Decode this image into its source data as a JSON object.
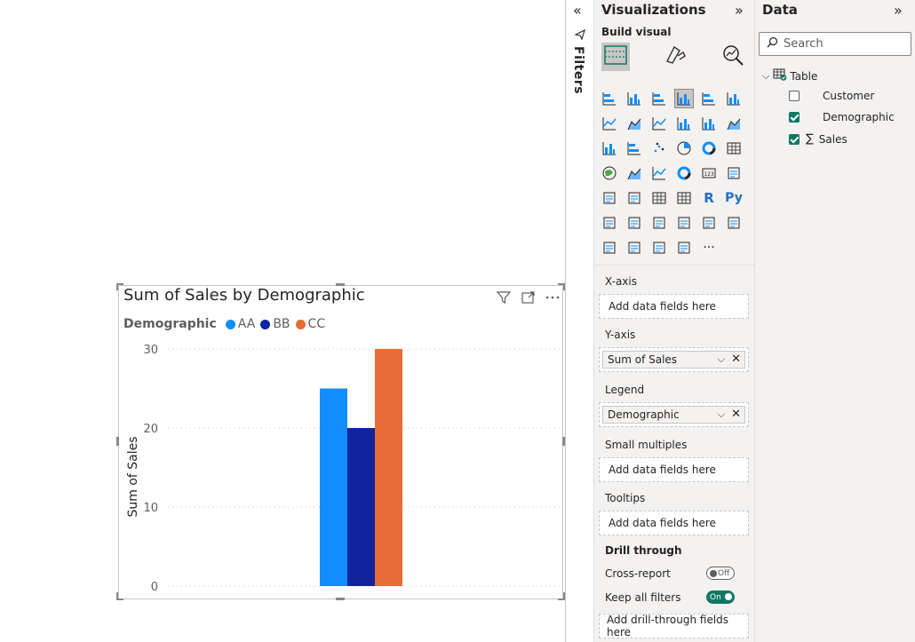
{
  "visual": {
    "title": "Sum of Sales by Demographic",
    "legend_title": "Demographic",
    "legend": [
      {
        "name": "AA",
        "color": "#118DFF"
      },
      {
        "name": "BB",
        "color": "#12239E"
      },
      {
        "name": "CC",
        "color": "#E66C37"
      }
    ]
  },
  "chart_data": {
    "type": "bar",
    "categories": [
      ""
    ],
    "series": [
      {
        "name": "AA",
        "values": [
          25
        ],
        "color": "#118DFF"
      },
      {
        "name": "BB",
        "values": [
          20
        ],
        "color": "#12239E"
      },
      {
        "name": "CC",
        "values": [
          30
        ],
        "color": "#E66C37"
      }
    ],
    "title": "Sum of Sales by Demographic",
    "xlabel": "",
    "ylabel": "Sum of Sales",
    "ylim": [
      0,
      30
    ],
    "yticks": [
      "0",
      "10",
      "20",
      "30"
    ],
    "grid": true,
    "legend_position": "top-left"
  },
  "filters": {
    "label": "Filters"
  },
  "viz_pane": {
    "title": "Visualizations",
    "build_label": "Build visual",
    "wells": [
      {
        "label": "X-axis",
        "placeholder": "Add data fields here"
      },
      {
        "label": "Y-axis",
        "field": "Sum of Sales"
      },
      {
        "label": "Legend",
        "field": "Demographic"
      },
      {
        "label": "Small multiples",
        "placeholder": "Add data fields here"
      },
      {
        "label": "Tooltips",
        "placeholder": "Add data fields here"
      }
    ],
    "drill": {
      "title": "Drill through",
      "cross_report": "Cross-report",
      "cross_report_state": "Off",
      "keep_filters": "Keep all filters",
      "keep_filters_state": "On",
      "add_fields": "Add drill-through fields here"
    },
    "more": "···",
    "r_label": "R",
    "py_label": "Py"
  },
  "data_pane": {
    "title": "Data",
    "search_placeholder": "Search",
    "table": "Table",
    "fields": [
      {
        "name": "Customer",
        "checked": false
      },
      {
        "name": "Demographic",
        "checked": true
      },
      {
        "name": "Sales",
        "checked": true,
        "sigma": true
      }
    ]
  },
  "colors": {
    "accent": "#117865"
  }
}
